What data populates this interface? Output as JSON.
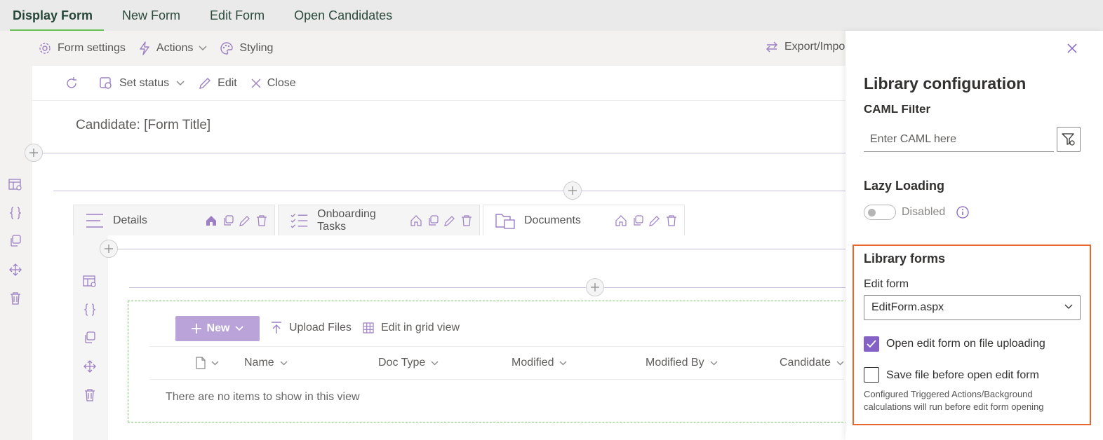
{
  "top_tabs": [
    "Display Form",
    "New Form",
    "Edit Form",
    "Open Candidates"
  ],
  "designer_bar": {
    "form_settings": "Form settings",
    "actions": "Actions",
    "styling": "Styling",
    "export": "Export/Impo"
  },
  "command_bar": {
    "set_status": "Set status",
    "edit": "Edit",
    "close": "Close"
  },
  "form_title": "Candidate: [Form Title]",
  "form_tabs": [
    "Details",
    "Onboarding Tasks",
    "Documents"
  ],
  "list": {
    "new_label": "New",
    "upload_label": "Upload Files",
    "grid_label": "Edit in grid view",
    "columns": [
      "Name",
      "Doc Type",
      "Modified",
      "Modified By",
      "Candidate"
    ],
    "empty_message": "There are no items to show in this view"
  },
  "panel": {
    "title": "Library configuration",
    "caml_label": "CAML Filter",
    "caml_placeholder": "Enter CAML here",
    "lazy_heading": "Lazy Loading",
    "lazy_state": "Disabled",
    "forms_heading": "Library forms",
    "edit_form_label": "Edit form",
    "edit_form_value": "EditForm.aspx",
    "open_edit_label": "Open edit form on file uploading",
    "open_edit_checked": true,
    "save_before_label": "Save file before open edit form",
    "save_before_checked": false,
    "note": "Configured Triggered Actions/Background calculations will run before edit form opening"
  },
  "colors": {
    "accent": "#8661c5",
    "highlight_border": "#e8652e",
    "active_tab_underline": "#6bbf59",
    "new_button": "#b9a3d9"
  }
}
